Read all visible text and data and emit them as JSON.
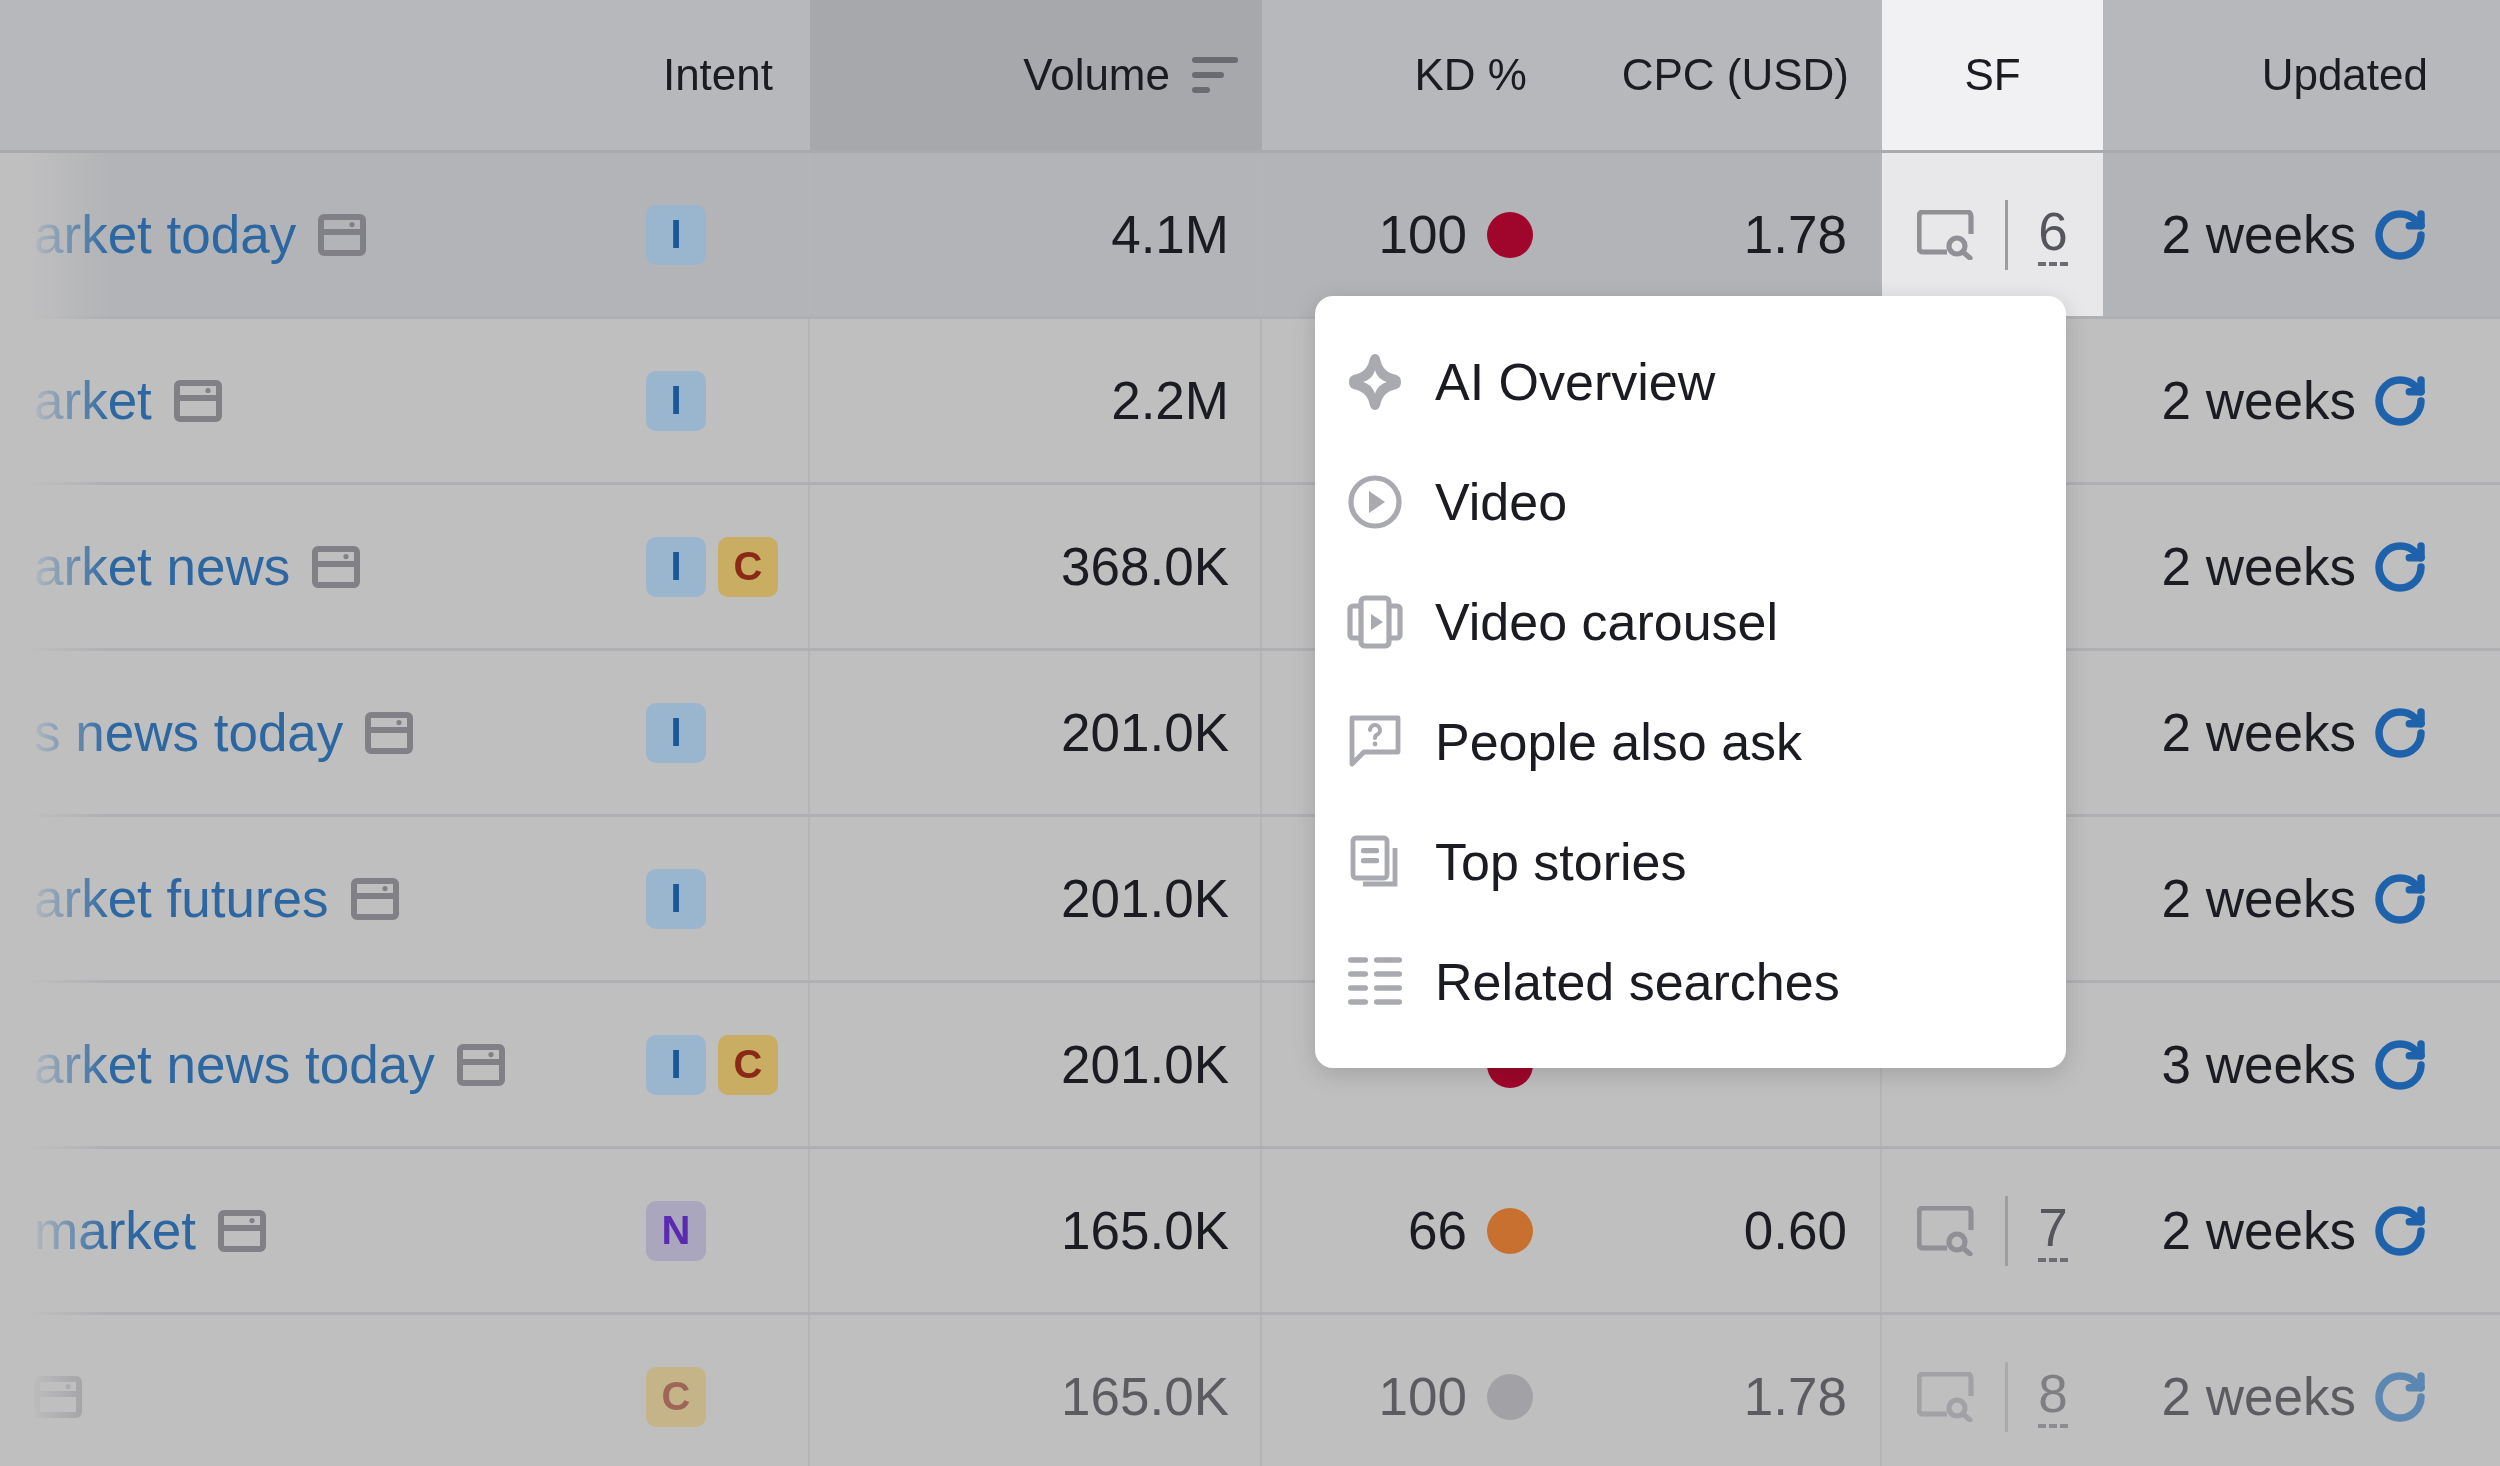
{
  "table": {
    "columns": [
      {
        "label": "Intent",
        "sorted": false,
        "highlighted": false
      },
      {
        "label": "Volume",
        "sorted": true,
        "highlighted": false
      },
      {
        "label": "KD %",
        "sorted": false,
        "highlighted": false
      },
      {
        "label": "CPC (USD)",
        "sorted": false,
        "highlighted": false
      },
      {
        "label": "SF",
        "sorted": false,
        "highlighted": true
      },
      {
        "label": "Updated",
        "sorted": false,
        "highlighted": false
      }
    ],
    "rows": [
      {
        "keyword": "arket today",
        "intents": [
          {
            "label": "I",
            "kind": "informational"
          }
        ],
        "volume": "4.1M",
        "kd": "100",
        "color": "#a0062b",
        "cpc": "1.78",
        "sf_count": "6",
        "updated": "2 weeks",
        "highlighted": true,
        "faded": false
      },
      {
        "keyword": "arket",
        "intents": [
          {
            "label": "I",
            "kind": "informational"
          }
        ],
        "volume": "2.2M",
        "updated": "2 weeks",
        "highlighted": false,
        "faded": false
      },
      {
        "keyword": "arket news",
        "intents": [
          {
            "label": "I",
            "kind": "informational"
          },
          {
            "label": "C",
            "kind": "commercial"
          }
        ],
        "volume": "368.0K",
        "updated": "2 weeks",
        "highlighted": false,
        "faded": false
      },
      {
        "keyword": "s news today",
        "intents": [
          {
            "label": "I",
            "kind": "informational"
          }
        ],
        "volume": "201.0K",
        "updated": "2 weeks",
        "highlighted": false,
        "faded": false
      },
      {
        "keyword": "arket futures",
        "intents": [
          {
            "label": "I",
            "kind": "informational"
          }
        ],
        "volume": "201.0K",
        "updated": "2 weeks",
        "highlighted": false,
        "faded": false
      },
      {
        "keyword": "arket news today",
        "intents": [
          {
            "label": "I",
            "kind": "informational"
          },
          {
            "label": "C",
            "kind": "commercial"
          }
        ],
        "volume": "201.0K",
        "color": "#a0062b",
        "updated": "3 weeks",
        "highlighted": false,
        "faded": false
      },
      {
        "keyword": "market",
        "intents": [
          {
            "label": "N",
            "kind": "navigational"
          }
        ],
        "volume": "165.0K",
        "kd": "66",
        "color": "#c8702f",
        "cpc": "0.60",
        "sf_count": "7",
        "updated": "2 weeks",
        "highlighted": false,
        "faded": false
      },
      {
        "intents": [
          {
            "label": "C",
            "kind": "commercial"
          }
        ],
        "volume": "165.0K",
        "kd": "100",
        "color": "#a2a2a6",
        "cpc": "1.78",
        "sf_count": "8",
        "updated": "2 weeks",
        "highlighted": false,
        "faded": true
      }
    ]
  },
  "sf_menu": {
    "items": [
      {
        "label": "AI Overview",
        "kind": "sparkle"
      },
      {
        "label": "Video",
        "kind": "play"
      },
      {
        "label": "Video carousel",
        "kind": "carousel"
      },
      {
        "label": "People also ask",
        "kind": "question"
      },
      {
        "label": "Top stories",
        "kind": "stories"
      },
      {
        "label": "Related searches",
        "kind": "list"
      }
    ]
  }
}
